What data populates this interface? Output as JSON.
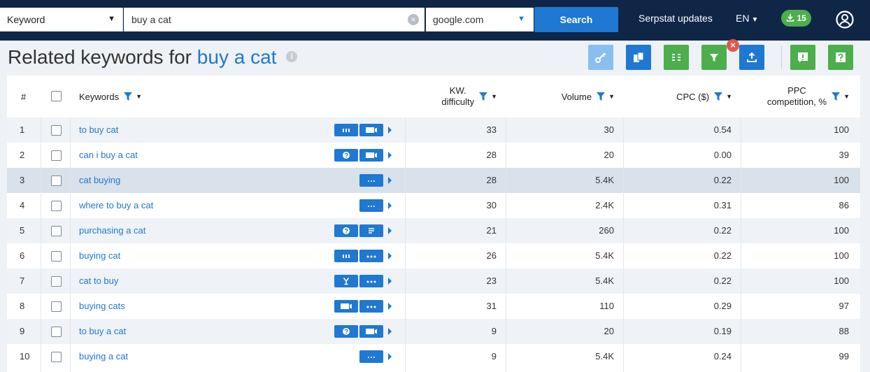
{
  "search_bar": {
    "type_label": "Keyword",
    "query_value": "buy a cat",
    "engine_value": "google.com",
    "search_label": "Search"
  },
  "header": {
    "updates_label": "Serpstat updates",
    "language": "EN",
    "downloads_count": "15"
  },
  "page": {
    "title_prefix": "Related keywords for",
    "title_keyword": "buy a cat"
  },
  "table": {
    "columns": {
      "index": "#",
      "keywords": "Keywords",
      "kd_line1": "KW.",
      "kd_line2": "difficulty",
      "volume": "Volume",
      "cpc": "CPC ($)",
      "ppc_line1": "PPC",
      "ppc_line2": "competition, %"
    },
    "rows": [
      {
        "n": "1",
        "keyword": "to buy cat",
        "kd": "33",
        "volume": "30",
        "cpc": "0.54",
        "ppc": "100",
        "features": [
          "bars-icon",
          "video-icon"
        ]
      },
      {
        "n": "2",
        "keyword": "can i buy a cat",
        "kd": "28",
        "volume": "20",
        "cpc": "0.00",
        "ppc": "39",
        "features": [
          "question-icon",
          "video-icon"
        ]
      },
      {
        "n": "3",
        "keyword": "cat buying",
        "kd": "28",
        "volume": "5.4K",
        "cpc": "0.22",
        "ppc": "100",
        "features": [
          "more-icon"
        ]
      },
      {
        "n": "4",
        "keyword": "where to buy a cat",
        "kd": "30",
        "volume": "2.4K",
        "cpc": "0.31",
        "ppc": "86",
        "features": [
          "more-icon"
        ]
      },
      {
        "n": "5",
        "keyword": "purchasing a cat",
        "kd": "21",
        "volume": "260",
        "cpc": "0.22",
        "ppc": "100",
        "features": [
          "question-icon",
          "list-icon"
        ]
      },
      {
        "n": "6",
        "keyword": "buying cat",
        "kd": "26",
        "volume": "5.4K",
        "cpc": "0.22",
        "ppc": "100",
        "features": [
          "bars-icon",
          "more-icon"
        ]
      },
      {
        "n": "7",
        "keyword": "cat to buy",
        "kd": "23",
        "volume": "5.4K",
        "cpc": "0.22",
        "ppc": "100",
        "features": [
          "filter-y-icon",
          "more-icon"
        ]
      },
      {
        "n": "8",
        "keyword": "buying cats",
        "kd": "31",
        "volume": "110",
        "cpc": "0.29",
        "ppc": "97",
        "features": [
          "video-icon",
          "more-icon"
        ]
      },
      {
        "n": "9",
        "keyword": "to buy a cat",
        "kd": "9",
        "volume": "20",
        "cpc": "0.19",
        "ppc": "88",
        "features": [
          "question-icon",
          "video-icon"
        ]
      },
      {
        "n": "10",
        "keyword": "buying a cat",
        "kd": "9",
        "volume": "5.4K",
        "cpc": "0.24",
        "ppc": "99",
        "features": [
          "more-icon"
        ]
      }
    ]
  },
  "colors": {
    "topbar": "#0f2647",
    "accent_blue": "#1f78d1",
    "green": "#4cae4c",
    "error_red": "#e2574c"
  }
}
